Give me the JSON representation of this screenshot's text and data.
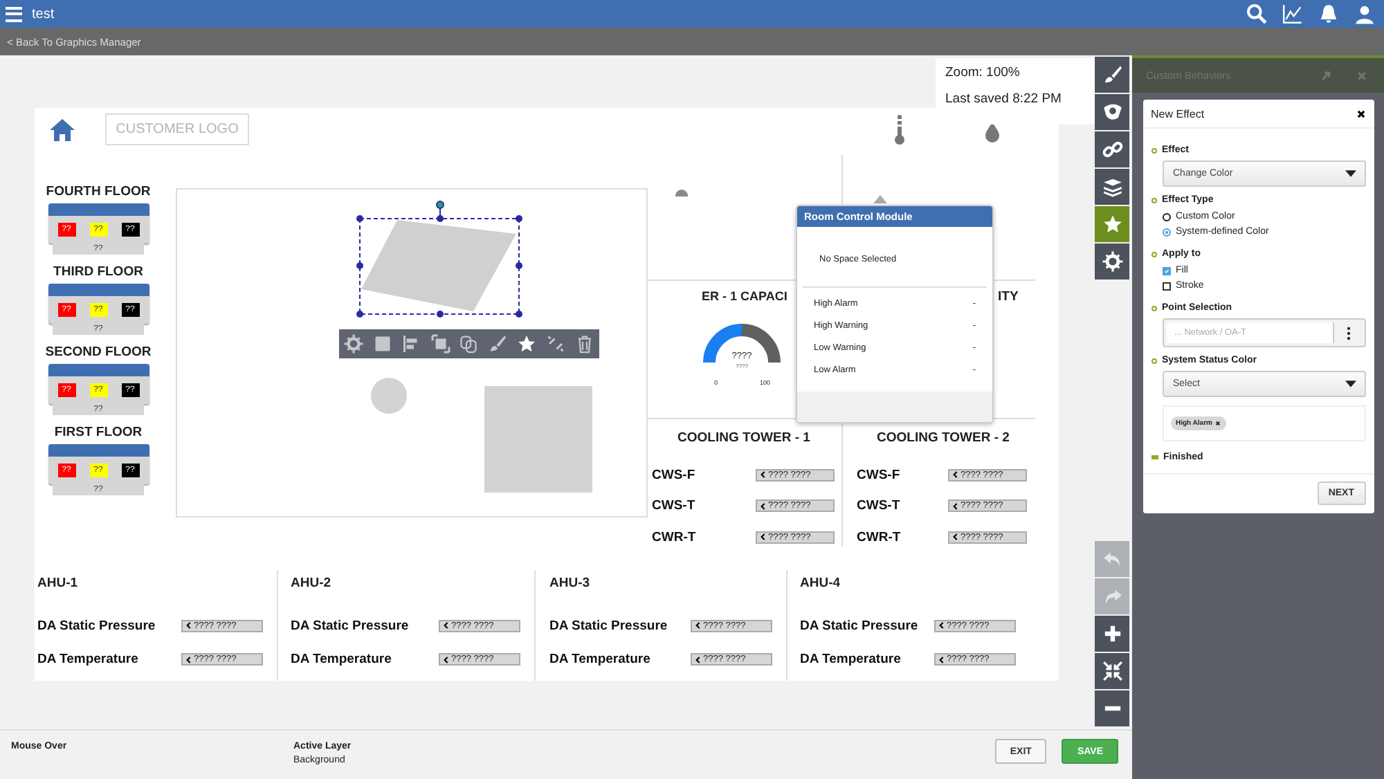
{
  "top_bar": {
    "title": "test",
    "icons": [
      {
        "kind": "search"
      },
      {
        "kind": "chart"
      },
      {
        "kind": "bell"
      },
      {
        "kind": "user"
      }
    ]
  },
  "back_link": "< Back To Graphics Manager",
  "zoom_info": {
    "zoom": "Zoom: 100%",
    "last_saved": "Last saved 8:22 PM"
  },
  "canvas": {
    "logo": "CUSTOMER LOGO",
    "floors": [
      {
        "name": "FOURTH FLOOR",
        "chips": [
          {
            "text": "??",
            "color": "#ff0000"
          },
          {
            "text": "??",
            "color": "#ffff00"
          },
          {
            "text": "??",
            "color": "#000000"
          }
        ],
        "footer": "??"
      },
      {
        "name": "THIRD FLOOR",
        "chips": [
          {
            "text": "??",
            "color": "#ff0000"
          },
          {
            "text": "??",
            "color": "#ffff00"
          },
          {
            "text": "??",
            "color": "#000000"
          }
        ],
        "footer": "??"
      },
      {
        "name": "SECOND FLOOR",
        "chips": [
          {
            "text": "??",
            "color": "#ff0000"
          },
          {
            "text": "??",
            "color": "#ffff00"
          },
          {
            "text": "??",
            "color": "#000000"
          }
        ],
        "footer": "??"
      },
      {
        "name": "FIRST FLOOR",
        "chips": [
          {
            "text": "??",
            "color": "#ff0000"
          },
          {
            "text": "??",
            "color": "#ffff00"
          },
          {
            "text": "??",
            "color": "#000000"
          }
        ],
        "footer": "??"
      }
    ],
    "context_tools": [
      {
        "kind": "gears"
      },
      {
        "kind": "fill"
      },
      {
        "kind": "align"
      },
      {
        "kind": "front"
      },
      {
        "kind": "copy"
      },
      {
        "kind": "brush"
      },
      {
        "kind": "star"
      },
      {
        "kind": "unlink"
      },
      {
        "kind": "trash"
      }
    ],
    "chiller": {
      "title_left": "ER - 1 CAPACI",
      "title_right": "ITY",
      "gauge": {
        "value": "????",
        "unit": "????",
        "min": "0",
        "max": "100",
        "level": 0.5
      }
    },
    "popup": {
      "title": "Room Control Module",
      "message": "No Space Selected",
      "rows": [
        {
          "label": "High Alarm",
          "value": "-"
        },
        {
          "label": "High Warning",
          "value": "-"
        },
        {
          "label": "Low Warning",
          "value": "-"
        },
        {
          "label": "Low Alarm",
          "value": "-"
        }
      ]
    },
    "cooling_towers": [
      {
        "title": "COOLING TOWER - 1",
        "rows": [
          {
            "label": "CWS-F",
            "value": "???? ????"
          },
          {
            "label": "CWS-T",
            "value": "???? ????"
          },
          {
            "label": "CWR-T",
            "value": "???? ????"
          }
        ]
      },
      {
        "title": "COOLING TOWER - 2",
        "rows": [
          {
            "label": "CWS-F",
            "value": "???? ????"
          },
          {
            "label": "CWS-T",
            "value": "???? ????"
          },
          {
            "label": "CWR-T",
            "value": "???? ????"
          }
        ]
      }
    ],
    "ahus": [
      {
        "title": "AHU-1",
        "rows": [
          {
            "label": "DA Static Pressure",
            "value": "???? ????"
          },
          {
            "label": "DA Temperature",
            "value": "???? ????"
          }
        ]
      },
      {
        "title": "AHU-2",
        "rows": [
          {
            "label": "DA Static Pressure",
            "value": "???? ????"
          },
          {
            "label": "DA Temperature",
            "value": "???? ????"
          }
        ]
      },
      {
        "title": "AHU-3",
        "rows": [
          {
            "label": "DA Static Pressure",
            "value": "???? ????"
          },
          {
            "label": "DA Temperature",
            "value": "???? ????"
          }
        ]
      },
      {
        "title": "AHU-4",
        "rows": [
          {
            "label": "DA Static Pressure",
            "value": "???? ????"
          },
          {
            "label": "DA Temperature",
            "value": "???? ????"
          }
        ]
      }
    ]
  },
  "tools": [
    {
      "kind": "brush",
      "selected": false
    },
    {
      "kind": "eye",
      "selected": false
    },
    {
      "kind": "link",
      "selected": false
    },
    {
      "kind": "layers",
      "selected": false
    },
    {
      "kind": "star",
      "selected": true
    },
    {
      "kind": "gear",
      "selected": false
    }
  ],
  "view_tools": [
    {
      "kind": "undo",
      "disabled": true
    },
    {
      "kind": "redo",
      "disabled": true
    },
    {
      "kind": "zoom-in",
      "disabled": false
    },
    {
      "kind": "fit",
      "disabled": false
    },
    {
      "kind": "zoom-out",
      "disabled": false
    }
  ],
  "behaviors_panel": {
    "title": "Custom Behaviors",
    "dialog": {
      "title": "New Effect",
      "effect": {
        "label": "Effect",
        "value": "Change Color"
      },
      "effect_type": {
        "label": "Effect Type",
        "options": [
          {
            "label": "Custom Color",
            "selected": false
          },
          {
            "label": "System-defined Color",
            "selected": true
          }
        ]
      },
      "apply_to": {
        "label": "Apply to",
        "options": [
          {
            "label": "Fill",
            "checked": true
          },
          {
            "label": "Stroke",
            "checked": false
          }
        ]
      },
      "point_selection": {
        "label": "Point Selection",
        "placeholder": "... Network / OA-T"
      },
      "status_color": {
        "label": "System Status Color",
        "value": "Select",
        "tags": [
          {
            "label": "High Alarm"
          }
        ]
      },
      "finished": "Finished",
      "next": "NEXT"
    }
  },
  "status_bar": {
    "mouse_over": "Mouse Over",
    "active_layer_label": "Active Layer",
    "active_layer": "Background"
  },
  "buttons": [
    {
      "kind": "exit",
      "label": "EXIT"
    },
    {
      "kind": "save",
      "label": "SAVE"
    }
  ]
}
